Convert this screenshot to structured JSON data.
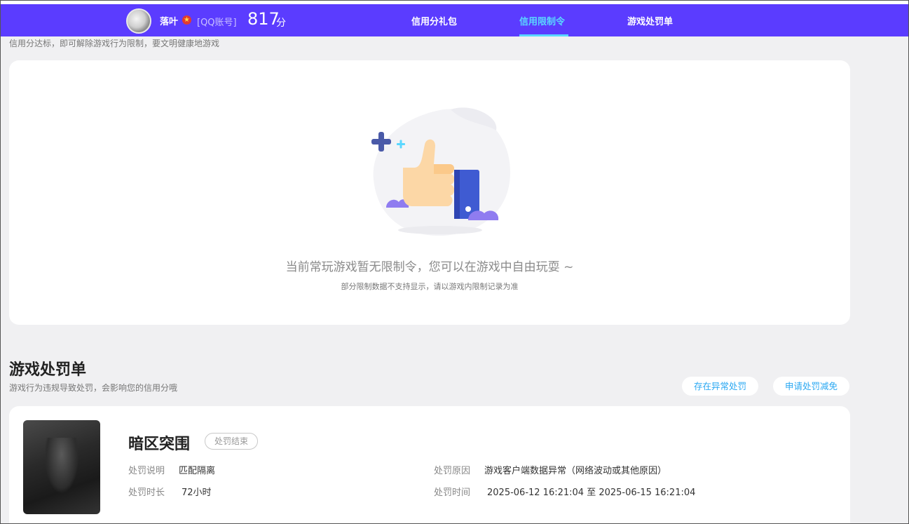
{
  "header": {
    "nickname": "落叶",
    "account_type": "[QQ账号]",
    "score": "817",
    "score_unit": "分",
    "nav": [
      {
        "label": "信用分礼包",
        "active": false
      },
      {
        "label": "信用限制令",
        "active": true
      },
      {
        "label": "游戏处罚单",
        "active": false
      }
    ],
    "bg_color": "#5b3cff",
    "active_color": "#5ad7ff"
  },
  "restriction": {
    "note": "信用分达标，即可解除游戏行为限制，要文明健康地游戏",
    "empty_title": "当前常玩游戏暂无限制令，您可以在游戏中自由玩耍 ~",
    "empty_sub": "部分限制数据不支持显示，请以游戏内限制记录为准"
  },
  "penalty": {
    "title": "游戏处罚单",
    "desc": "游戏行为违规导致处罚，会影响您的信用分哦",
    "buttons": [
      "存在异常处罚",
      "申请处罚减免"
    ],
    "item": {
      "game": "暗区突围",
      "status": "处罚结束",
      "desc_label": "处罚说明",
      "desc_value": "匹配隔离",
      "duration_label": "处罚时长",
      "duration_value": "72小时",
      "reason_label": "处罚原因",
      "reason_value": "游戏客户端数据异常（网络波动或其他原因）",
      "time_label": "处罚时间",
      "time_value": "2025-06-12 16:21:04 至 2025-06-15 16:21:04"
    }
  }
}
